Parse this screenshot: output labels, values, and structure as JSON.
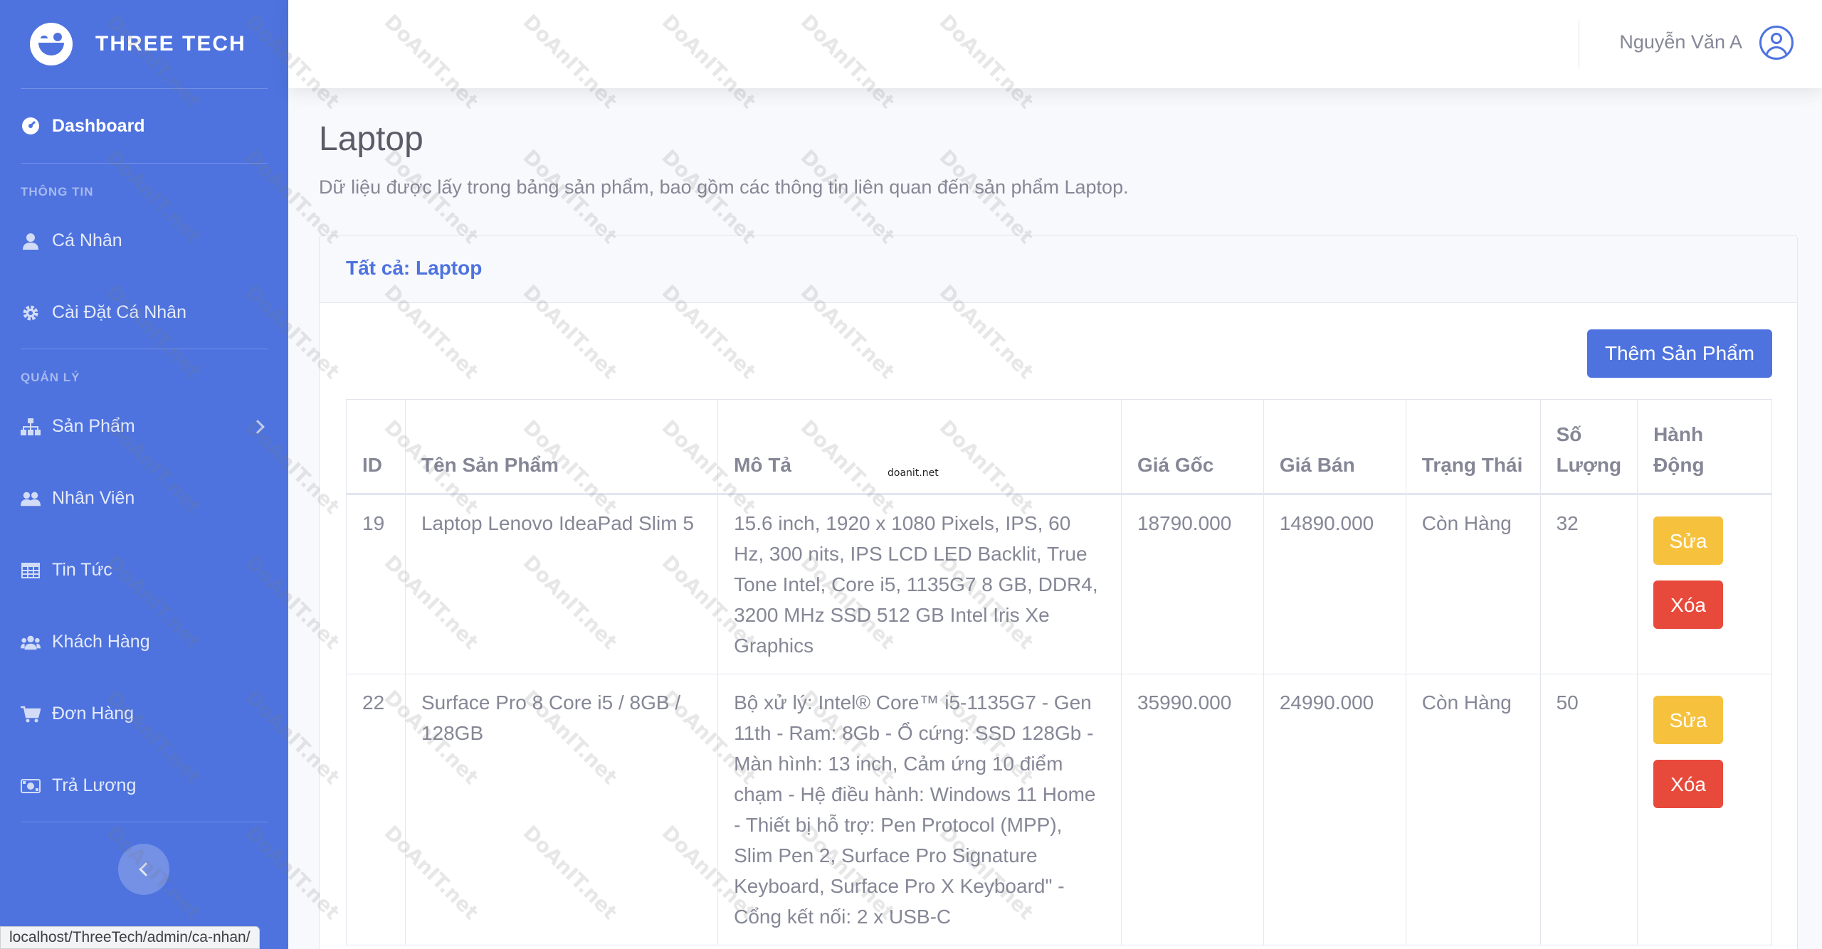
{
  "sidebar": {
    "brand": "THREE TECH",
    "dashboard": "Dashboard",
    "section_info": "THÔNG TIN",
    "info_items": [
      "Cá Nhân",
      "Cài Đặt Cá Nhân"
    ],
    "section_manage": "QUẢN LÝ",
    "manage_items": [
      "Sản Phẩm",
      "Nhân Viên",
      "Tin Tức",
      "Khách Hàng",
      "Đơn Hàng",
      "Trả Lương"
    ]
  },
  "topbar": {
    "user_name": "Nguyễn Văn A"
  },
  "page": {
    "title": "Laptop",
    "description": "Dữ liệu được lấy trong bảng sản phẩm, bao gồm các thông tin liên quan đến sản phẩm Laptop."
  },
  "card": {
    "header": "Tất cả: Laptop",
    "add_button": "Thêm Sản Phẩm"
  },
  "table": {
    "headers": [
      "ID",
      "Tên Sản Phẩm",
      "Mô Tả",
      "Giá Gốc",
      "Giá Bán",
      "Trạng Thái",
      "Số Lượng",
      "Hành Động"
    ],
    "rows": [
      {
        "id": "19",
        "name": "Laptop Lenovo IdeaPad Slim 5",
        "desc": "15.6 inch, 1920 x 1080 Pixels, IPS, 60 Hz, 300 nits, IPS LCD LED Backlit, True Tone Intel, Core i5, 1135G7 8 GB, DDR4, 3200 MHz SSD 512 GB Intel Iris Xe Graphics",
        "price_orig": "18790.000",
        "price_sale": "14890.000",
        "status": "Còn Hàng",
        "qty": "32"
      },
      {
        "id": "22",
        "name": "Surface Pro 8 Core i5 / 8GB / 128GB",
        "desc": "Bộ xử lý: Intel® Core™ i5-1135G7 - Gen 11th - Ram: 8Gb - Ổ cứng: SSD 128Gb - Màn hình: 13 inch, Cảm ứng 10 điểm chạm - Hệ điều hành: Windows 11 Home - Thiết bị hỗ trợ: Pen Protocol (MPP), Slim Pen 2, Surface Pro Signature Keyboard, Surface Pro X Keyboard\" - Cổng kết nối: 2 x USB-C",
        "price_orig": "35990.000",
        "price_sale": "24990.000",
        "status": "Còn Hàng",
        "qty": "50"
      }
    ],
    "edit_label": "Sửa",
    "delete_label": "Xóa"
  },
  "statusbar": {
    "url": "localhost/ThreeTech/admin/ca-nhan/"
  },
  "watermark": {
    "text": "DoAnIT.net",
    "small": "doanit.net"
  },
  "colors": {
    "primary": "#4e73df",
    "warning": "#f6c23e",
    "danger": "#e74a3b",
    "text_gray": "#858796"
  }
}
